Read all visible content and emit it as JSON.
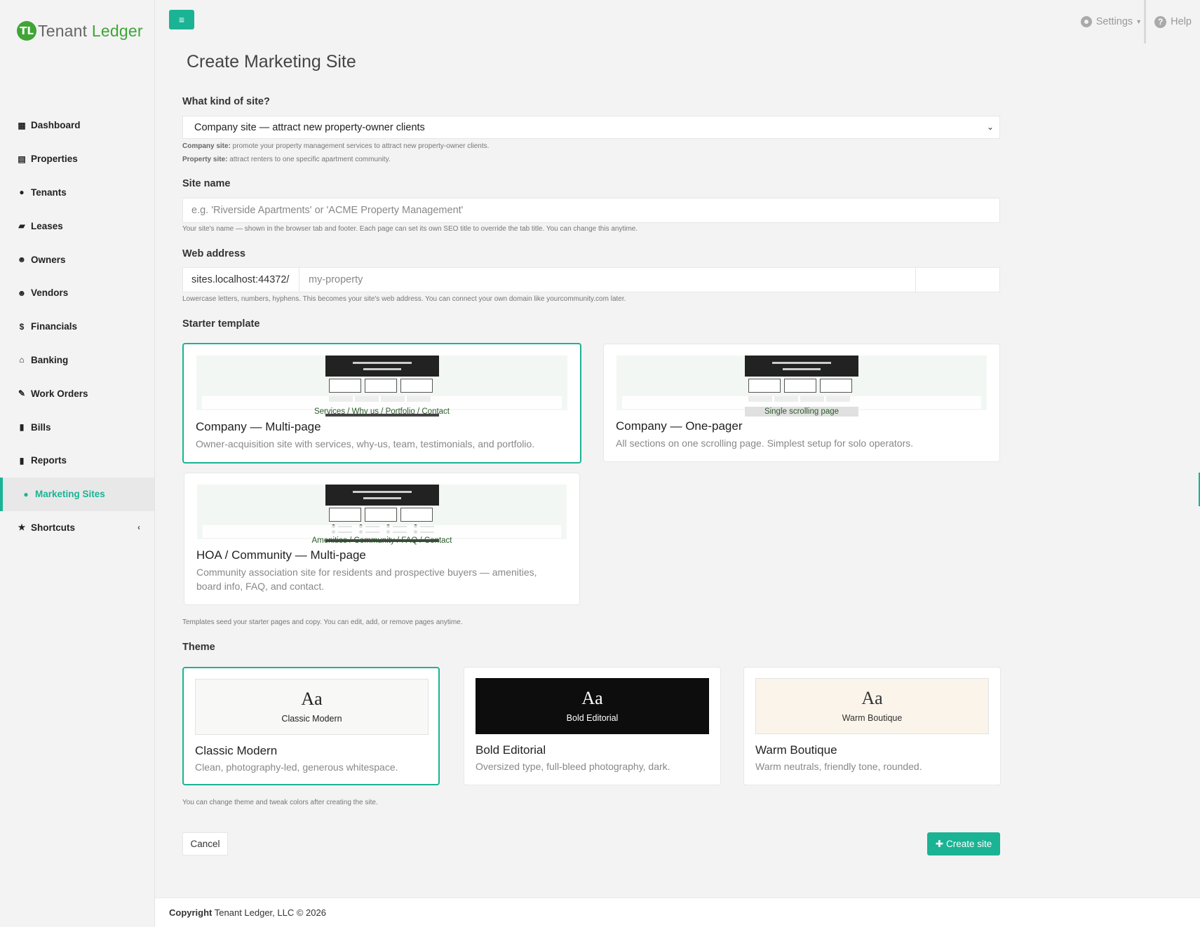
{
  "brand": {
    "mark": "TL",
    "name_part1": "Tenant ",
    "name_part2": "Ledger",
    "accent": "#3fa535",
    "primary": "#1ab394"
  },
  "sidebar": {
    "items": [
      {
        "label": "Dashboard",
        "icon": "dashboard-icon",
        "glyph": "▦"
      },
      {
        "label": "Properties",
        "icon": "building-icon",
        "glyph": "▤"
      },
      {
        "label": "Tenants",
        "icon": "user-icon",
        "glyph": "●"
      },
      {
        "label": "Leases",
        "icon": "folder-open-icon",
        "glyph": "▰"
      },
      {
        "label": "Owners",
        "icon": "users-icon",
        "glyph": "☻"
      },
      {
        "label": "Vendors",
        "icon": "users-icon",
        "glyph": "☻"
      },
      {
        "label": "Financials",
        "icon": "dollar-icon",
        "glyph": "$"
      },
      {
        "label": "Banking",
        "icon": "bank-icon",
        "glyph": "⌂"
      },
      {
        "label": "Work Orders",
        "icon": "edit-icon",
        "glyph": "✎"
      },
      {
        "label": "Bills",
        "icon": "file-icon",
        "glyph": "▮"
      },
      {
        "label": "Reports",
        "icon": "file-icon",
        "glyph": "▮"
      },
      {
        "label": "Marketing Sites",
        "icon": "globe-icon",
        "glyph": "●",
        "active": true
      },
      {
        "label": "Shortcuts",
        "icon": "star-icon",
        "glyph": "★",
        "chevron": "‹"
      }
    ]
  },
  "topbar": {
    "menu_glyph": "≡",
    "settings_label": "Settings",
    "settings_caret": "▾",
    "help_label": "Help",
    "help_glyph": "?"
  },
  "page": {
    "title": "Create Marketing Site"
  },
  "kind": {
    "label": "What kind of site?",
    "selected": "Company site — attract new property-owner clients",
    "caret": "⌄",
    "help1_bold": "Company site:",
    "help1_text": " promote your property management services to attract new property-owner clients.",
    "help2_bold": "Property site:",
    "help2_text": " attract renters to one specific apartment community."
  },
  "site_name": {
    "label": "Site name",
    "placeholder": "e.g. 'Riverside Apartments' or 'ACME Property Management'",
    "help": "Your site's name — shown in the browser tab and footer. Each page can set its own SEO title to override the tab title. You can change this anytime."
  },
  "web_address": {
    "label": "Web address",
    "prefix": "sites.localhost:44372/",
    "placeholder": "my-property",
    "help": "Lowercase letters, numbers, hyphens. This becomes your site's web address. You can connect your own domain like yourcommunity.com later."
  },
  "templates": {
    "label": "Starter template",
    "items": [
      {
        "title": "Company — Multi-page",
        "caption": "Services / Why us / Portfolio / Contact",
        "desc": "Owner-acquisition site with services, why-us, team, testimonials, and portfolio.",
        "selected": true
      },
      {
        "title": "Company — One-pager",
        "caption": "Single scrolling page",
        "desc": "All sections on one scrolling page. Simplest setup for solo operators.",
        "selected": false
      },
      {
        "title": "HOA / Community — Multi-page",
        "caption": "Amenities / Community / FAQ / Contact",
        "desc": "Community association site for residents and prospective buyers — amenities, board info, FAQ, and contact.",
        "selected": false
      }
    ],
    "help": "Templates seed your starter pages and copy. You can edit, add, or remove pages anytime."
  },
  "themes": {
    "label": "Theme",
    "items": [
      {
        "sample": "Aa",
        "preview_name": "Classic Modern",
        "title": "Classic Modern",
        "desc": "Clean, photography-led, generous whitespace.",
        "bg": "#f8f8f7",
        "fg": "#222222",
        "selected": true
      },
      {
        "sample": "Aa",
        "preview_name": "Bold Editorial",
        "title": "Bold Editorial",
        "desc": "Oversized type, full-bleed photography, dark.",
        "bg": "#0d0d0d",
        "fg": "#ffffff",
        "selected": false
      },
      {
        "sample": "Aa",
        "preview_name": "Warm Boutique",
        "title": "Warm Boutique",
        "desc": "Warm neutrals, friendly tone, rounded.",
        "bg": "#fbf4ea",
        "fg": "#333333",
        "selected": false
      }
    ],
    "help": "You can change theme and tweak colors after creating the site."
  },
  "actions": {
    "cancel": "Cancel",
    "create": "Create site",
    "create_glyph": "✚"
  },
  "footer": {
    "bold": "Copyright",
    "text": " Tenant Ledger, LLC © 2026"
  }
}
